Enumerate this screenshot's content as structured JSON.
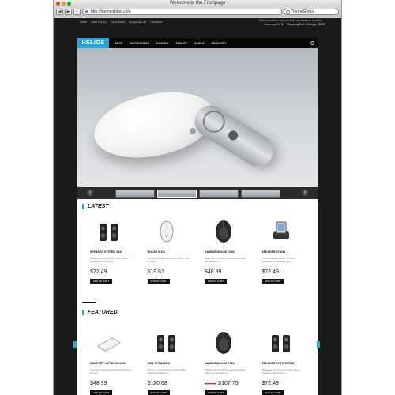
{
  "browser": {
    "window_title": "Welcome to the Frontpage",
    "url": "http://themeglobal.com",
    "search_text": "ThemeGlobal",
    "nav_buttons": [
      "◀",
      "▶",
      "+"
    ]
  },
  "topbar": {
    "links": [
      "Home",
      "Wish List (0)",
      "My Account",
      "Shopping Cart",
      "Checkout"
    ],
    "welcome": "Welcome visitor you can login or create an account.",
    "currency": "Currency: € £ $",
    "cart": "Shopping Cart 0 item(s) - $0.00"
  },
  "nav": {
    "logo": "HELIOS",
    "items": [
      "MICE",
      "KEYBOARDS",
      "GAMING",
      "TABLET",
      "AUDIO",
      "SECURITY"
    ]
  },
  "slider": {
    "prev_label": "‹",
    "next_label": "›",
    "thumb_count": 4,
    "active_thumb": 2
  },
  "latest": {
    "title": "LATEST",
    "products": [
      {
        "name": "SPEAKER SYSTEM Z320",
        "desc": "Wherever you go in the room, these speakers will sound in...",
        "price": "$72.49",
        "old_price": "",
        "cart": "ADD TO CART",
        "icon": "speakers-icon"
      },
      {
        "name": "MOUSE M110",
        "desc": "Setup is a snap: Connect by either USB or PS/2,...",
        "price": "$19.61",
        "old_price": "",
        "cart": "ADD TO CART",
        "icon": "white-mouse-icon"
      },
      {
        "name": "GAMING MOUSE G500",
        "desc": "Stop your on-screen in their tracks with the warning ne...",
        "price": "$48.99",
        "old_price": "",
        "cart": "ADD TO CART",
        "icon": "gaming-mouse-icon"
      },
      {
        "name": "SPEAKER STAND",
        "desc": "Unprecedented power. The next generation of processing te...",
        "price": "$72.49",
        "old_price": "",
        "cart": "ADD TO CART",
        "icon": "speaker-stand-icon"
      }
    ]
  },
  "featured": {
    "title": "FEATURED",
    "products": [
      {
        "name": "COMFORT LAPDESK N100",
        "desc": "Intel Core 2 Duo processor Powered by an Intel...",
        "price": "$48.99",
        "old_price": "",
        "cart": "ADD TO CART",
        "icon": "lapdesk-icon"
      },
      {
        "name": "LS11 SPEAKERS",
        "desc": "iPhone is a revolutionary new mobile phone that allows yo...",
        "price": "$120.68",
        "old_price": "",
        "cart": "ADD TO CART",
        "icon": "speakers-icon"
      },
      {
        "name": "GAMING MOUSE G700",
        "desc": "The 30-inch Apple Cinema HD Display delivers an amazing 2...",
        "price": "$107.75",
        "old_price": "$119.68",
        "cart": "ADD TO CART",
        "icon": "gaming-mouse-icon"
      },
      {
        "name": "SPEAKER SYSTEM Z520",
        "desc": "Wherever you go in the room, these speakers will sound in...",
        "price": "$72.49",
        "old_price": "",
        "cart": "ADD TO CART",
        "icon": "speakers-icon"
      }
    ]
  },
  "colors": {
    "accent": "#28a5d4",
    "dark_bg": "#1a1a1a",
    "nav_bg": "#0a0a0a"
  }
}
